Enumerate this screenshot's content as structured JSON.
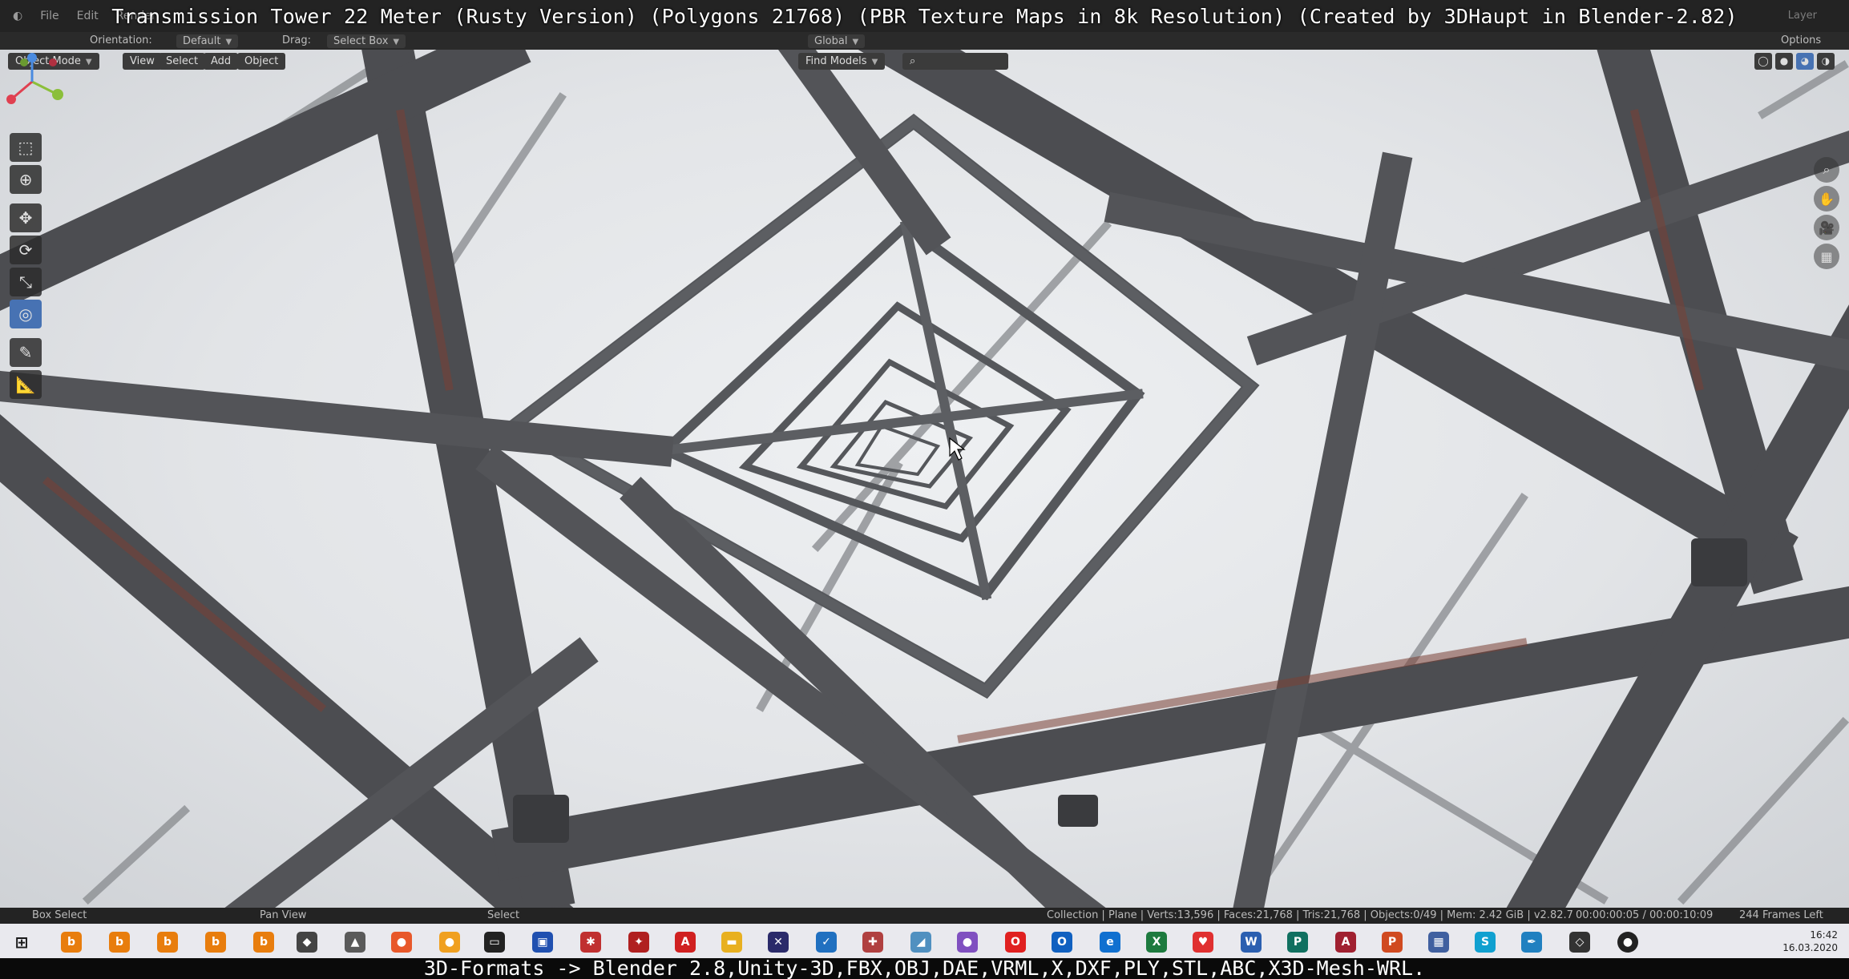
{
  "title_overlay": "Transmission Tower 22 Meter (Rusty Version) (Polygons 21768) (PBR Texture Maps in 8k Resolution) (Created by 3DHaupt in Blender-2.82)",
  "menu": {
    "file": "File",
    "edit": "Edit",
    "render": "Render",
    "layer": "Layer"
  },
  "header": {
    "orientation_label": "Orientation:",
    "orientation_value": "Default",
    "drag_label": "Drag:",
    "drag_value": "Select Box",
    "transform_value": "Global",
    "options_label": "Options"
  },
  "toolbar": {
    "mode": "Object Mode",
    "view": "View",
    "select": "Select",
    "add": "Add",
    "object": "Object",
    "find_models": "Find Models"
  },
  "status": {
    "left_hint": "Box Select",
    "middle_hint": "Pan View",
    "right_hint": "Select",
    "scene_info": "Collection | Plane | Verts:13,596 | Faces:21,768 | Tris:21,768 | Objects:0/49 | Mem: 2.42 GiB | v2.82.7",
    "timecode": "00:00:00:05 / 00:00:10:09",
    "frames_left": "244 Frames Left"
  },
  "clock": {
    "time": "16:42",
    "date": "16.03.2020"
  },
  "formats_banner": "3D-Formats -> Blender 2.8,Unity-3D,FBX,OBJ,DAE,VRML,X,DXF,PLY,STL,ABC,X3D-Mesh-WRL.",
  "colors": {
    "accent": "#4772b3",
    "steel": "#4a4a4d",
    "rust": "#7a3f35",
    "sky": "#e6e8eb"
  }
}
